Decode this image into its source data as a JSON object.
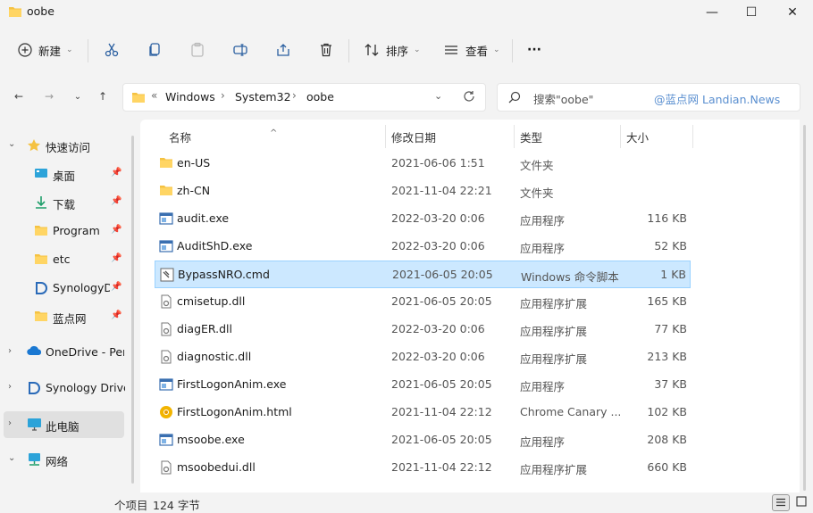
{
  "window": {
    "title": "oobe",
    "controls": {
      "minimize": "—",
      "maximize": "☐",
      "close": "✕"
    }
  },
  "toolbar": {
    "new_label": "新建",
    "sort_label": "排序",
    "view_label": "查看",
    "more_label": "···"
  },
  "address": {
    "overflow": "«",
    "crumbs": [
      "Windows",
      "System32",
      "oobe"
    ],
    "separator": "›"
  },
  "search": {
    "placeholder": "搜索\"oobe\"",
    "watermark": "@蓝点网 Landian.News"
  },
  "navpane": {
    "items": [
      {
        "label": "快速访问",
        "icon": "star-icon"
      },
      {
        "label": "桌面",
        "icon": "desktop-icon",
        "pinned": true
      },
      {
        "label": "下载",
        "icon": "download-icon",
        "pinned": true
      },
      {
        "label": "Program",
        "icon": "folder-icon",
        "pinned": true
      },
      {
        "label": "etc",
        "icon": "folder-icon",
        "pinned": true
      },
      {
        "label": "SynologyDrive",
        "icon": "synology-icon",
        "pinned": true
      },
      {
        "label": "蓝点网",
        "icon": "folder-icon",
        "pinned": true
      },
      {
        "label": "OneDrive - Personal",
        "icon": "cloud-icon"
      },
      {
        "label": "Synology Drive",
        "icon": "synology-icon"
      },
      {
        "label": "此电脑",
        "icon": "pc-icon"
      },
      {
        "label": "网络",
        "icon": "network-icon"
      }
    ]
  },
  "columns": {
    "name": "名称",
    "date": "修改日期",
    "type": "类型",
    "size": "大小"
  },
  "files": [
    {
      "name": "en-US",
      "date": "2021-06-06 1:51",
      "type": "文件夹",
      "size": "",
      "icon": "folder-icon"
    },
    {
      "name": "zh-CN",
      "date": "2021-11-04 22:21",
      "type": "文件夹",
      "size": "",
      "icon": "folder-icon"
    },
    {
      "name": "audit.exe",
      "date": "2022-03-20 0:06",
      "type": "应用程序",
      "size": "116 KB",
      "icon": "exe-icon"
    },
    {
      "name": "AuditShD.exe",
      "date": "2022-03-20 0:06",
      "type": "应用程序",
      "size": "52 KB",
      "icon": "exe-icon"
    },
    {
      "name": "BypassNRO.cmd",
      "date": "2021-06-05 20:05",
      "type": "Windows 命令脚本",
      "size": "1 KB",
      "icon": "cmd-icon",
      "selected": true
    },
    {
      "name": "cmisetup.dll",
      "date": "2021-06-05 20:05",
      "type": "应用程序扩展",
      "size": "165 KB",
      "icon": "dll-icon"
    },
    {
      "name": "diagER.dll",
      "date": "2022-03-20 0:06",
      "type": "应用程序扩展",
      "size": "77 KB",
      "icon": "dll-icon"
    },
    {
      "name": "diagnostic.dll",
      "date": "2022-03-20 0:06",
      "type": "应用程序扩展",
      "size": "213 KB",
      "icon": "dll-icon"
    },
    {
      "name": "FirstLogonAnim.exe",
      "date": "2021-06-05 20:05",
      "type": "应用程序",
      "size": "37 KB",
      "icon": "exe-icon"
    },
    {
      "name": "FirstLogonAnim.html",
      "date": "2021-11-04 22:12",
      "type": "Chrome Canary ...",
      "size": "102 KB",
      "icon": "chrome-canary-icon"
    },
    {
      "name": "msoobe.exe",
      "date": "2021-06-05 20:05",
      "type": "应用程序",
      "size": "208 KB",
      "icon": "exe-icon"
    },
    {
      "name": "msoobedui.dll",
      "date": "2021-11-04 22:12",
      "type": "应用程序扩展",
      "size": "660 KB",
      "icon": "dll-icon"
    }
  ],
  "status": {
    "count": "个项目",
    "size": "124 字节"
  },
  "colors": {
    "accent": "#0067c0",
    "folder": "#f5c242",
    "selection": "#cce8ff",
    "watermark": "#5a8fd0"
  }
}
